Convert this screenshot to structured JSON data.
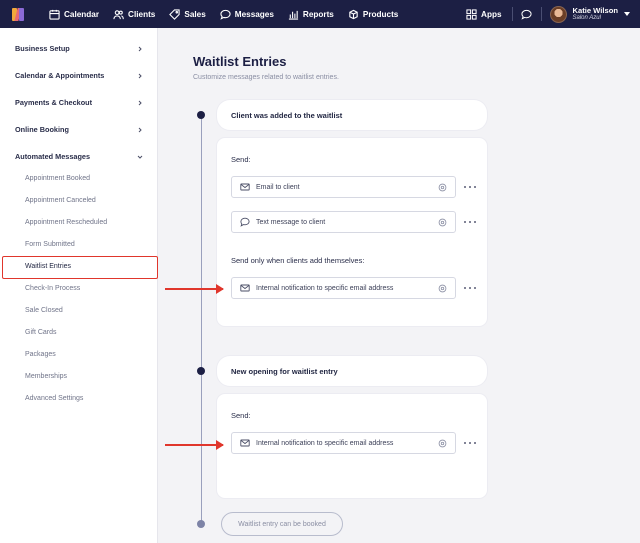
{
  "nav": {
    "items": [
      {
        "label": "Calendar",
        "icon": "calendar-icon"
      },
      {
        "label": "Clients",
        "icon": "clients-icon"
      },
      {
        "label": "Sales",
        "icon": "tag-icon"
      },
      {
        "label": "Messages",
        "icon": "message-icon"
      },
      {
        "label": "Reports",
        "icon": "chart-icon"
      },
      {
        "label": "Products",
        "icon": "box-icon"
      }
    ],
    "apps_label": "Apps",
    "user_name": "Katie Wilson",
    "user_business": "Salon Azul"
  },
  "sidebar": {
    "sections": [
      {
        "label": "Business Setup"
      },
      {
        "label": "Calendar & Appointments"
      },
      {
        "label": "Payments & Checkout"
      },
      {
        "label": "Online Booking"
      },
      {
        "label": "Automated Messages"
      }
    ],
    "subitems": [
      "Appointment Booked",
      "Appointment Canceled",
      "Appointment Rescheduled",
      "Form Submitted",
      "Waitlist Entries",
      "Check-In Process",
      "Sale Closed",
      "Gift Cards",
      "Packages",
      "Memberships",
      "Advanced Settings"
    ]
  },
  "main": {
    "title": "Waitlist Entries",
    "subtitle": "Customize messages related to waitlist entries.",
    "step1": {
      "title": "Client was added to the waitlist",
      "send_label": "Send:",
      "email_label": "Email to client",
      "text_label": "Text message to client",
      "conditional_label": "Send only when clients add themselves:",
      "internal_label": "Internal notification to specific email address"
    },
    "step2": {
      "title": "New opening for waitlist entry",
      "send_label": "Send:",
      "internal_label": "Internal notification to specific email address"
    },
    "step3": {
      "title": "Waitlist entry can be booked"
    }
  },
  "colors": {
    "nav_bg": "#1c1f44",
    "highlight_red": "#e0362c"
  }
}
